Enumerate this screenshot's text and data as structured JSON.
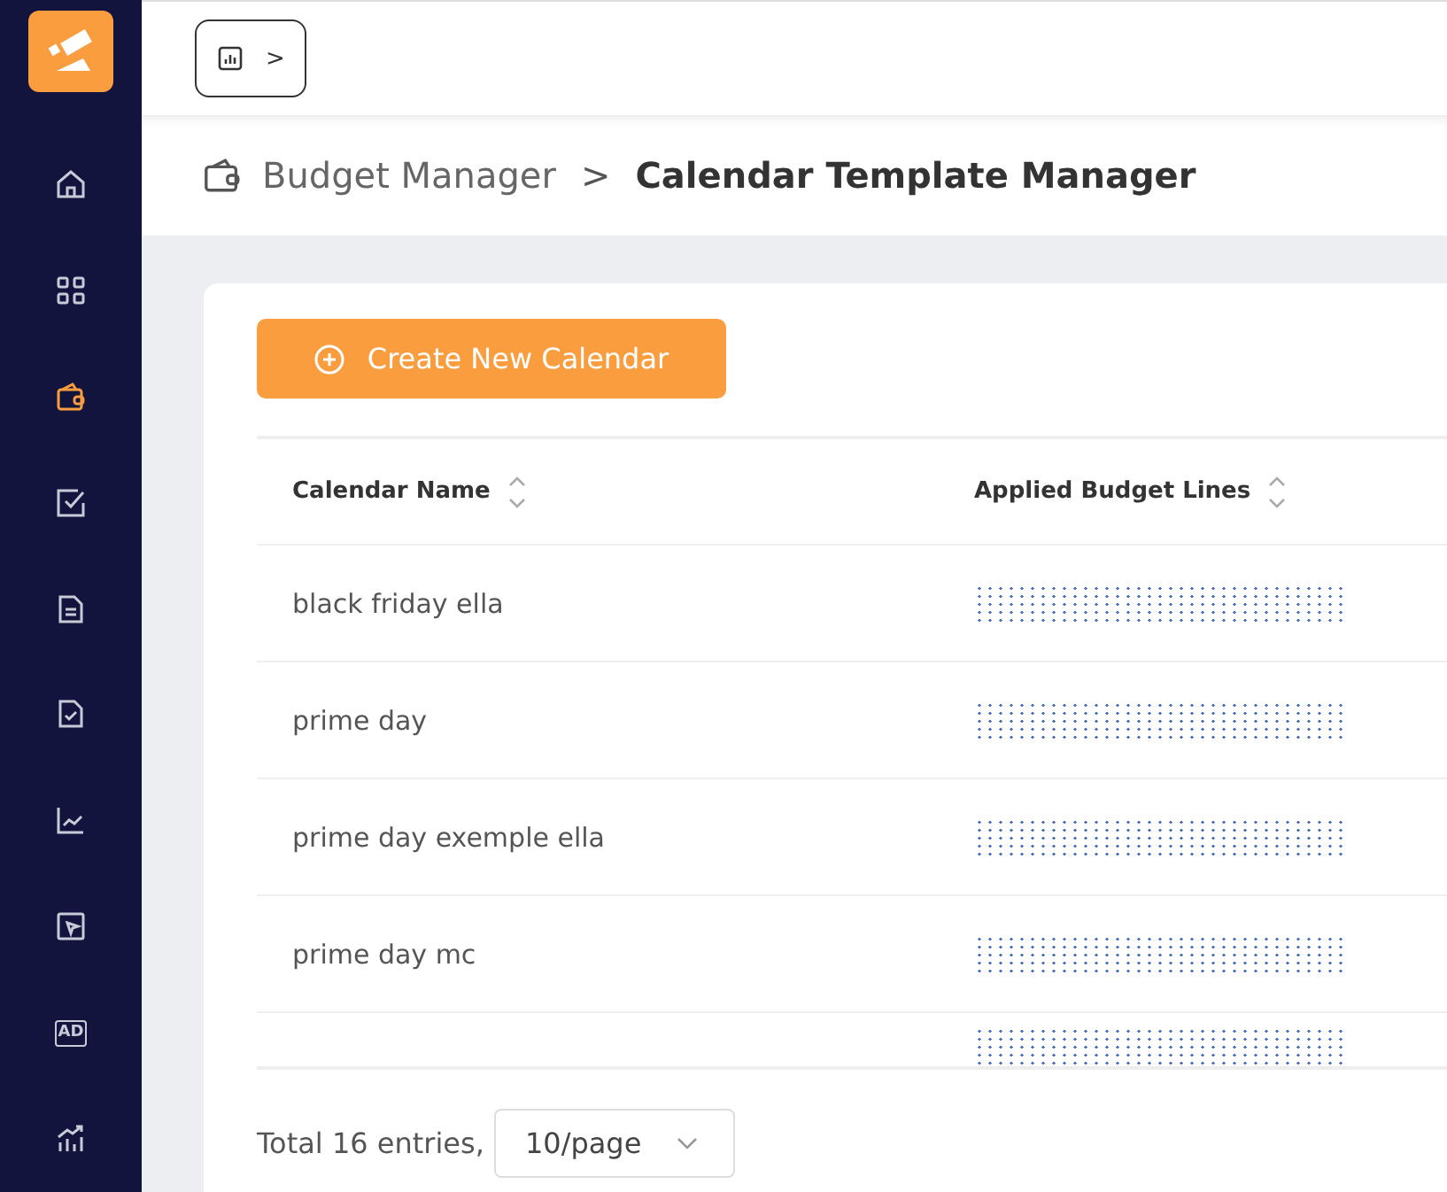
{
  "sidebar": {
    "items": [
      {
        "selected": false
      },
      {
        "selected": false
      },
      {
        "selected": true
      },
      {
        "selected": false
      },
      {
        "selected": false
      },
      {
        "selected": false
      },
      {
        "selected": false
      },
      {
        "selected": false
      },
      {
        "kind": "label",
        "selected": false
      },
      {
        "selected": false
      }
    ],
    "ad_label": "AD"
  },
  "toolbar": {
    "toggle_arrow": ">"
  },
  "breadcrumb": {
    "parent": "Budget Manager",
    "separator": ">",
    "current": "Calendar Template Manager"
  },
  "create_button": "Create New Calendar",
  "table": {
    "columns": [
      "Calendar Name",
      "Applied Budget Lines"
    ],
    "rows": [
      {
        "name": "black friday ella",
        "redacted": true
      },
      {
        "name": "prime day",
        "redacted": true
      },
      {
        "name": "prime day exemple ella",
        "redacted": true
      },
      {
        "name": "prime day mc",
        "redacted": true
      }
    ]
  },
  "footer": {
    "total": "Total 16 entries,",
    "page_size": "10/page"
  }
}
